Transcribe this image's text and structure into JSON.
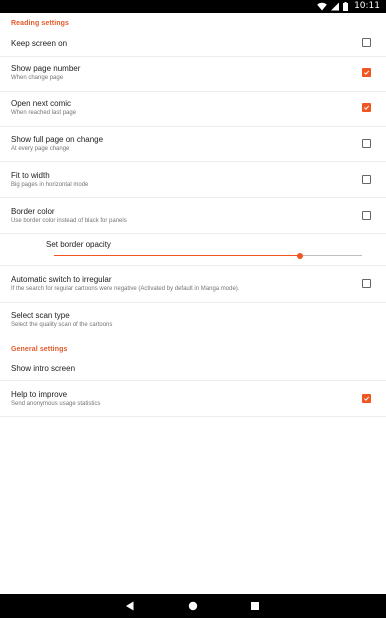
{
  "status_bar": {
    "time": "10:11",
    "icons": [
      "wifi-icon",
      "signal-icon",
      "battery-icon"
    ]
  },
  "sections": {
    "reading": {
      "header": "Reading settings"
    },
    "general": {
      "header": "General settings"
    }
  },
  "prefs": {
    "keep_screen_on": {
      "title": "Keep screen on",
      "checked": false
    },
    "show_page_number": {
      "title": "Show page number",
      "summary": "When change page",
      "checked": true
    },
    "open_next_comic": {
      "title": "Open next comic",
      "summary": "When reached last page",
      "checked": true
    },
    "show_full_page": {
      "title": "Show full page on change",
      "summary": "At every page change",
      "checked": false
    },
    "fit_to_width": {
      "title": "Fit to width",
      "summary": "Big pages in horizontal mode",
      "checked": false
    },
    "border_color": {
      "title": "Border color",
      "summary": "Use border color instead of black for panels",
      "checked": false
    },
    "border_opacity": {
      "title": "Set border opacity",
      "value": 0.8
    },
    "auto_irregular": {
      "title": "Automatic switch to irregular",
      "summary": "If the search for regular cartoons were negative (Activated by default in Manga mode).",
      "checked": false
    },
    "scan_type": {
      "title": "Select scan type",
      "summary": "Select the quality scan of the cartoons"
    },
    "show_intro": {
      "title": "Show intro screen"
    },
    "help_improve": {
      "title": "Help to improve",
      "summary": "Send anonymous usage statistics",
      "checked": true
    }
  },
  "colors": {
    "accent": "#f05522",
    "section_header": "#e25b2a"
  },
  "nav_bar": {
    "buttons": [
      "back-icon",
      "home-icon",
      "recents-icon"
    ]
  }
}
